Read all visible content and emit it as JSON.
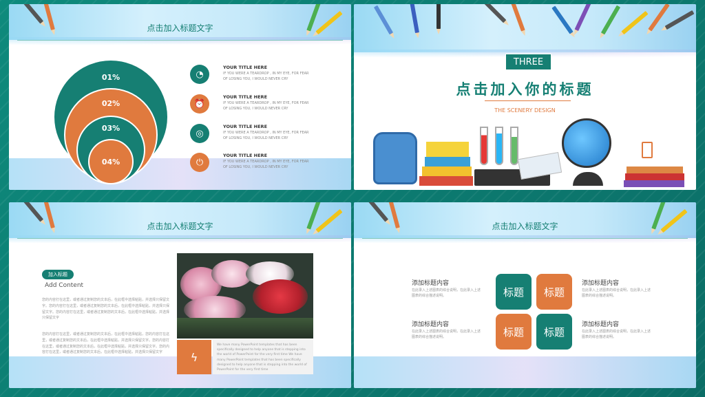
{
  "slide1": {
    "title": "点击加入标题文字",
    "circles": [
      "01%",
      "02%",
      "03%",
      "04%"
    ],
    "items": [
      {
        "title": "YOUR TITLE HERE",
        "text": "IF YOU WERE A TEARDROP , IN MY EYE, FOR FEAR OF LOSING YOU, I WOULD NEVER CRY",
        "icon": "pie-chart-icon"
      },
      {
        "title": "YOUR TITLE HERE",
        "text": "IF YOU WERE A TEARDROP , IN MY EYE, FOR FEAR OF LOSING YOU, I WOULD NEVER CRY",
        "icon": "alarm-clock-icon"
      },
      {
        "title": "YOUR TITLE HERE",
        "text": "IF YOU WERE A TEARDROP , IN MY EYE, FOR FEAR OF LOSING YOU, I WOULD NEVER CRY",
        "icon": "target-icon"
      },
      {
        "title": "YOUR TITLE HERE",
        "text": "IF YOU WERE A TEARDROP , IN MY EYE, FOR FEAR OF LOSING YOU, I WOULD NEVER CRY",
        "icon": "plug-icon"
      }
    ]
  },
  "slide2": {
    "badge": "THREE",
    "title": "点击加入你的标题",
    "subtitle": "THE SCENERY DESIGN"
  },
  "slide3": {
    "title": "点击加入标题文字",
    "pill": "加入标题",
    "heading": "Add Content",
    "para1": "您的内容打在这里，或者通过复制您的文本后，在此框中选择粘贴，并选择只保留文字。您的内容打在这里，或者通过复制您的文本后，在此框中选择粘贴，并选择只保留文字。您的内容打在这里，或者通过复制您的文本后，在此框中选择粘贴，并选择只保留文字",
    "para2": "您的内容打在这里，或者通过复制您的文本后，在此框中选择粘贴，您的内容打在这里，或者通过复制您的文本后，在此框中选择粘贴，并选择只保留文字。您的内容打在这里，或者通过复制您的文本后，在此框中选择粘贴，并选择只保留文字。您的内容打在这里，或者通过复制您的文本后，在此框中选择粘贴，并选择只保留文字",
    "box_text": "We have many PowerPoint templates that has been specifically designed to help anyone that is stepping into the world of PowerPoint for the very first time We have many PowerPoint templates that has been specifically designed to help anyone that is stepping into the world of PowerPoint for the very first time"
  },
  "slide4": {
    "title": "点击加入标题文字",
    "tiles": [
      "标题",
      "标题",
      "标题",
      "标题"
    ],
    "blocks": [
      {
        "label": "添加标题内容",
        "text": "在此录入上述图表的综合说明，在此录入上述图表的综合描述说明。"
      },
      {
        "label": "添加标题内容",
        "text": "在此录入上述图表的综合说明，在此录入上述图表的综合描述说明。"
      },
      {
        "label": "添加标题内容",
        "text": "在此录入上述图表的综合说明，在此录入上述图表的综合描述说明。"
      },
      {
        "label": "添加标题内容",
        "text": "在此录入上述图表的综合说明，在此录入上述图表的综合描述说明。"
      }
    ]
  },
  "colors": {
    "teal": "#167f73",
    "orange": "#e07a3e"
  }
}
